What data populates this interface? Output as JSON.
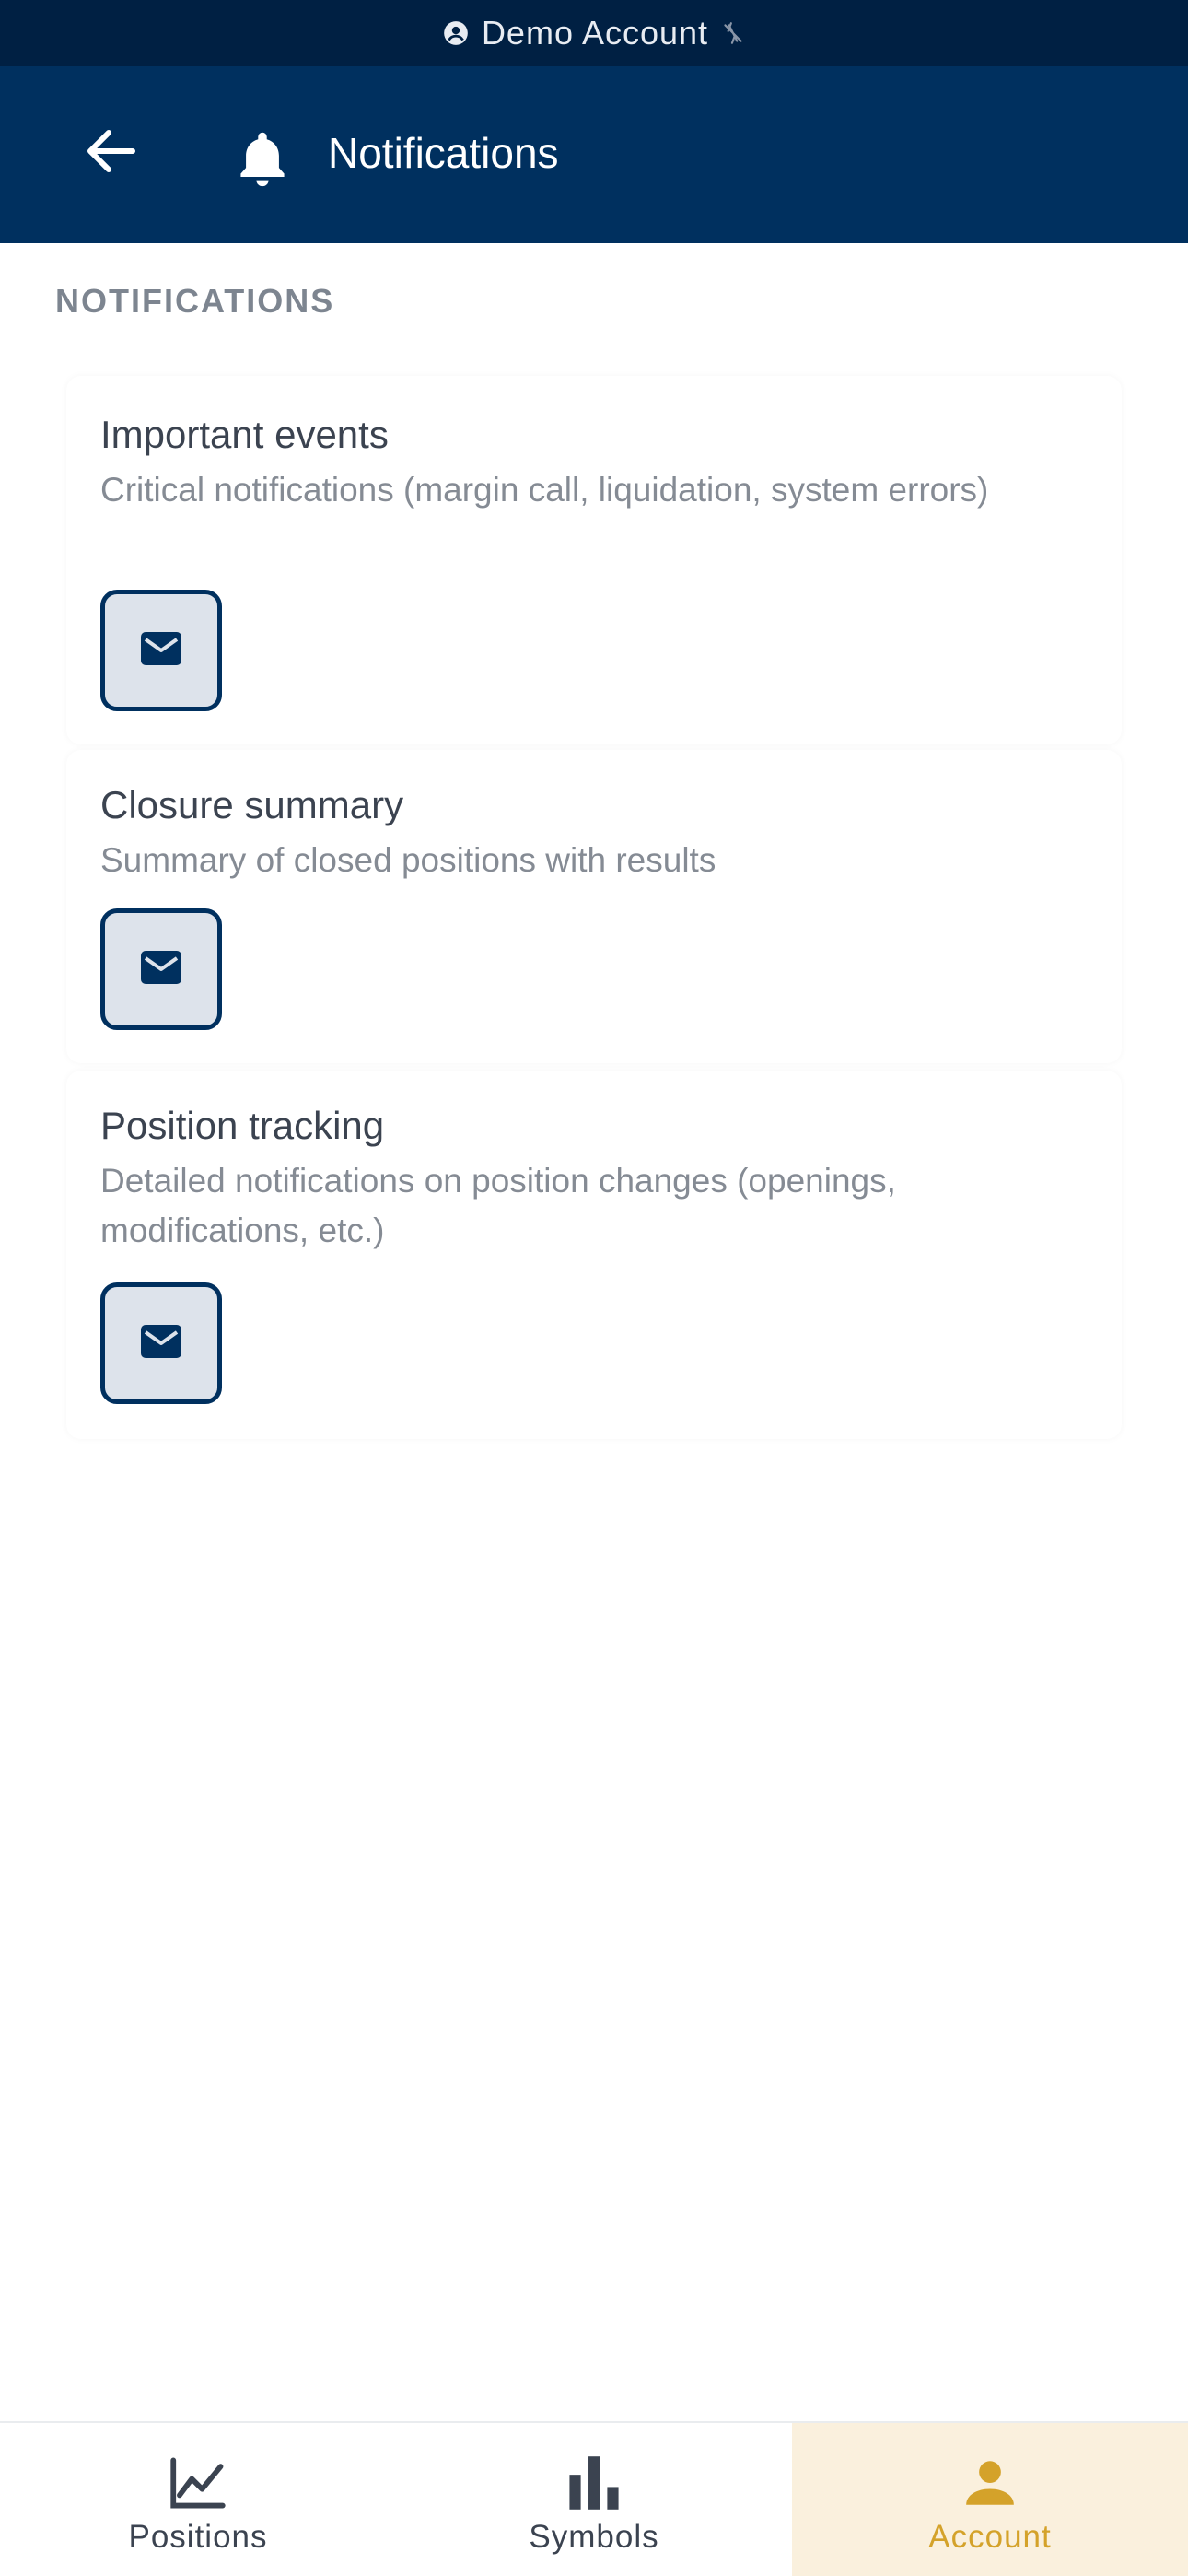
{
  "banner": {
    "label": "Demo Account",
    "user_icon": "account-circle-icon",
    "status_icon": "link-off-icon",
    "color": "#002043"
  },
  "header": {
    "back_icon": "arrow-left-icon",
    "bell_icon": "bell-icon",
    "title": "Notifications",
    "color": "#00305f"
  },
  "section": {
    "label": "NOTIFICATIONS"
  },
  "cards": [
    {
      "title": "Important events",
      "description": "Critical notifications (margin call, liquidation, system errors)",
      "channel_icon": "email-icon"
    },
    {
      "title": "Closure summary",
      "description": "Summary of closed positions with results",
      "channel_icon": "email-icon"
    },
    {
      "title": "Position tracking",
      "description": "Detailed notifications on position changes (openings, modifications, etc.)",
      "channel_icon": "email-icon"
    }
  ],
  "bottom_nav": {
    "items": [
      {
        "label": "Positions",
        "icon": "line-chart-icon",
        "active": false
      },
      {
        "label": "Symbols",
        "icon": "bar-chart-icon",
        "active": false
      },
      {
        "label": "Account",
        "icon": "person-icon",
        "active": true
      }
    ],
    "active_color": "#d4a22a",
    "active_background": "#faf0dd"
  }
}
